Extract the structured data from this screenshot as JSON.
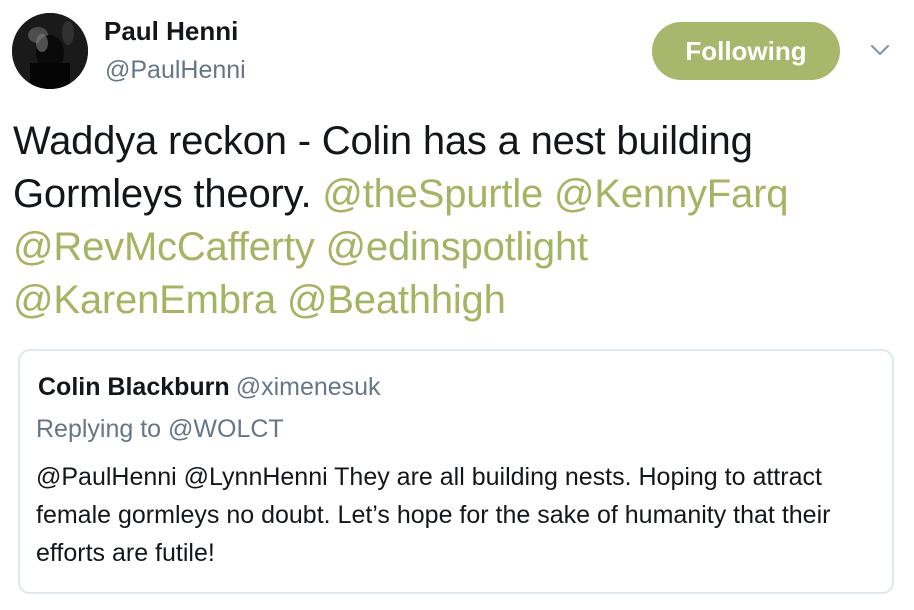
{
  "author": {
    "name": "Paul Henni",
    "handle": "@PaulHenni"
  },
  "follow_button": {
    "label": "Following",
    "color": "#a8b76b"
  },
  "menu": {
    "icon": "chevron-down-icon"
  },
  "tweet": {
    "text": "Waddya reckon - Colin has a nest building Gormleys theory.",
    "mentions": [
      "@theSpurtle",
      "@KennyFarq",
      "@RevMcCafferty",
      "@edinspotlight",
      "@KarenEmbra",
      "@Beathhigh"
    ],
    "mention_color": "#a3b562"
  },
  "quoted_tweet": {
    "author_name": "Colin Blackburn",
    "author_handle": "@ximenesuk",
    "replying_to": "Replying to @WOLCT",
    "text": "@PaulHenni @LynnHenni They are all building nests. Hoping to attract female gormleys no doubt. Let’s hope for the sake of humanity that their efforts are futile!"
  }
}
